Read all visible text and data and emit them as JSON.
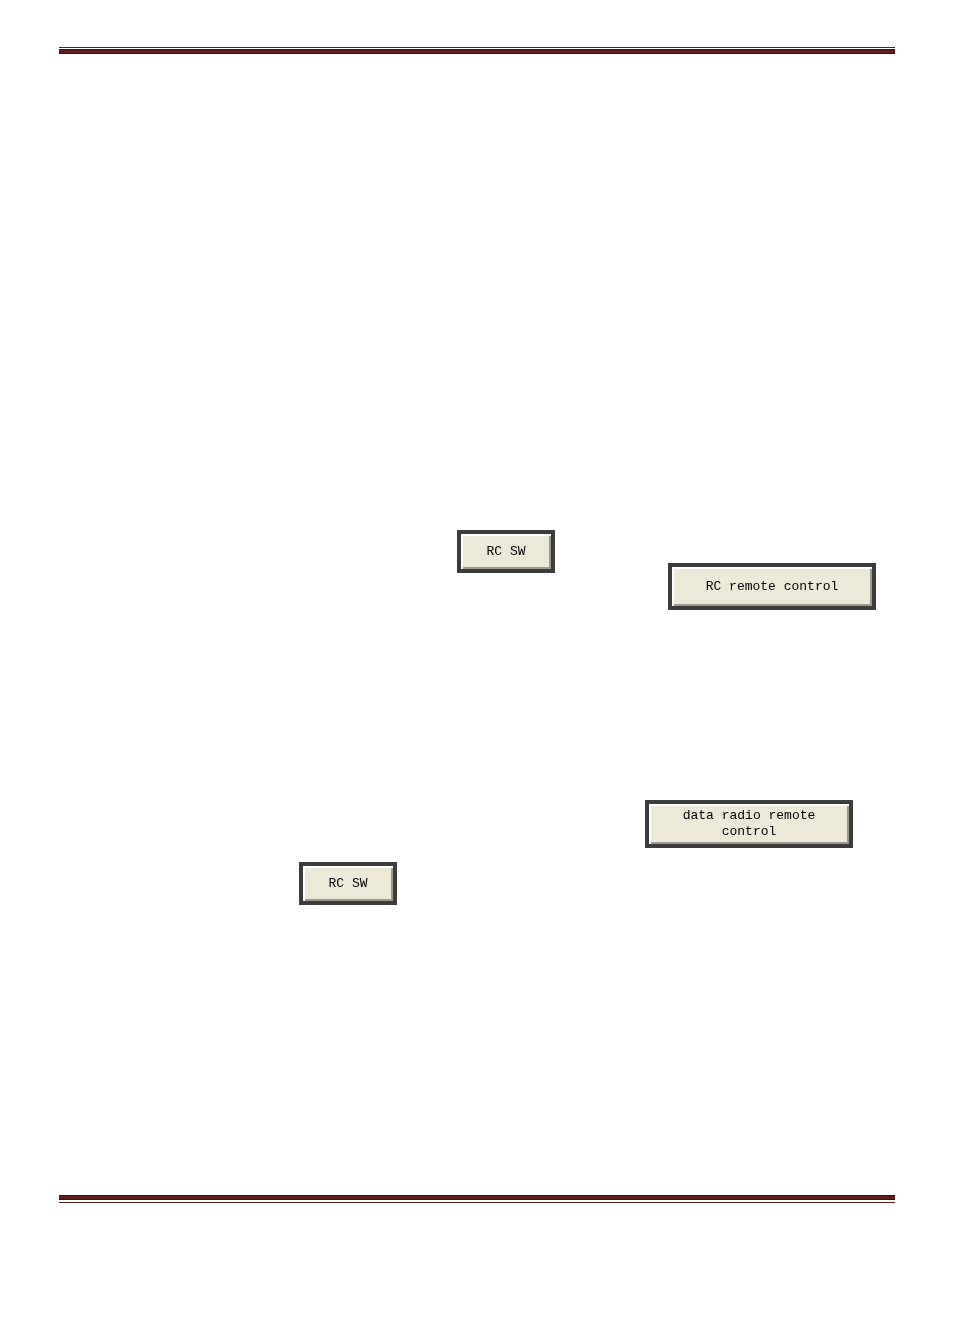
{
  "buttons": [
    {
      "label": "RC SW"
    },
    {
      "label": "RC remote control"
    },
    {
      "label": "data radio remote control"
    },
    {
      "label": "RC SW"
    }
  ]
}
